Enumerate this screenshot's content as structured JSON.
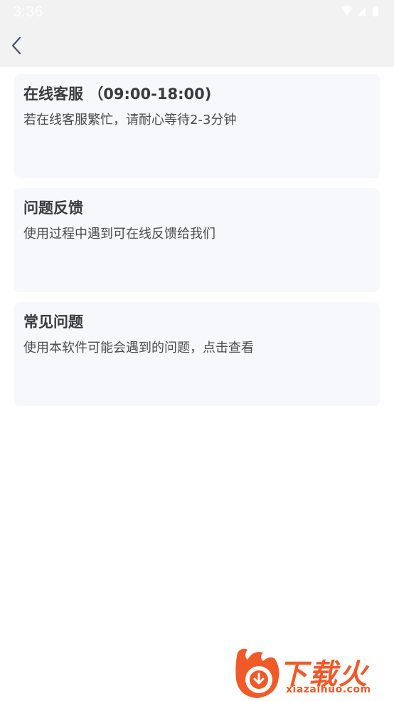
{
  "status_bar": {
    "time": "3:36"
  },
  "toolbar": {
    "back_icon": "chevron-left-icon"
  },
  "cards": [
    {
      "title": "在线客服 （09:00-18:00)",
      "description": "若在线客服繁忙，请耐心等待2-3分钟"
    },
    {
      "title": "问题反馈",
      "description": "使用过程中遇到可在线反馈给我们"
    },
    {
      "title": "常见问题",
      "description": "使用本软件可能会遇到的问题，点击查看"
    }
  ],
  "watermark": {
    "title": "下载火",
    "url": "xiazaihuo.com"
  },
  "colors": {
    "toolbar_bg": "#f2f2f2",
    "card_bg": "#f7f8fc",
    "title_text": "#3a3a3f",
    "desc_text": "#4a4a50",
    "back_icon": "#4a5268",
    "watermark": "#f05a28"
  }
}
